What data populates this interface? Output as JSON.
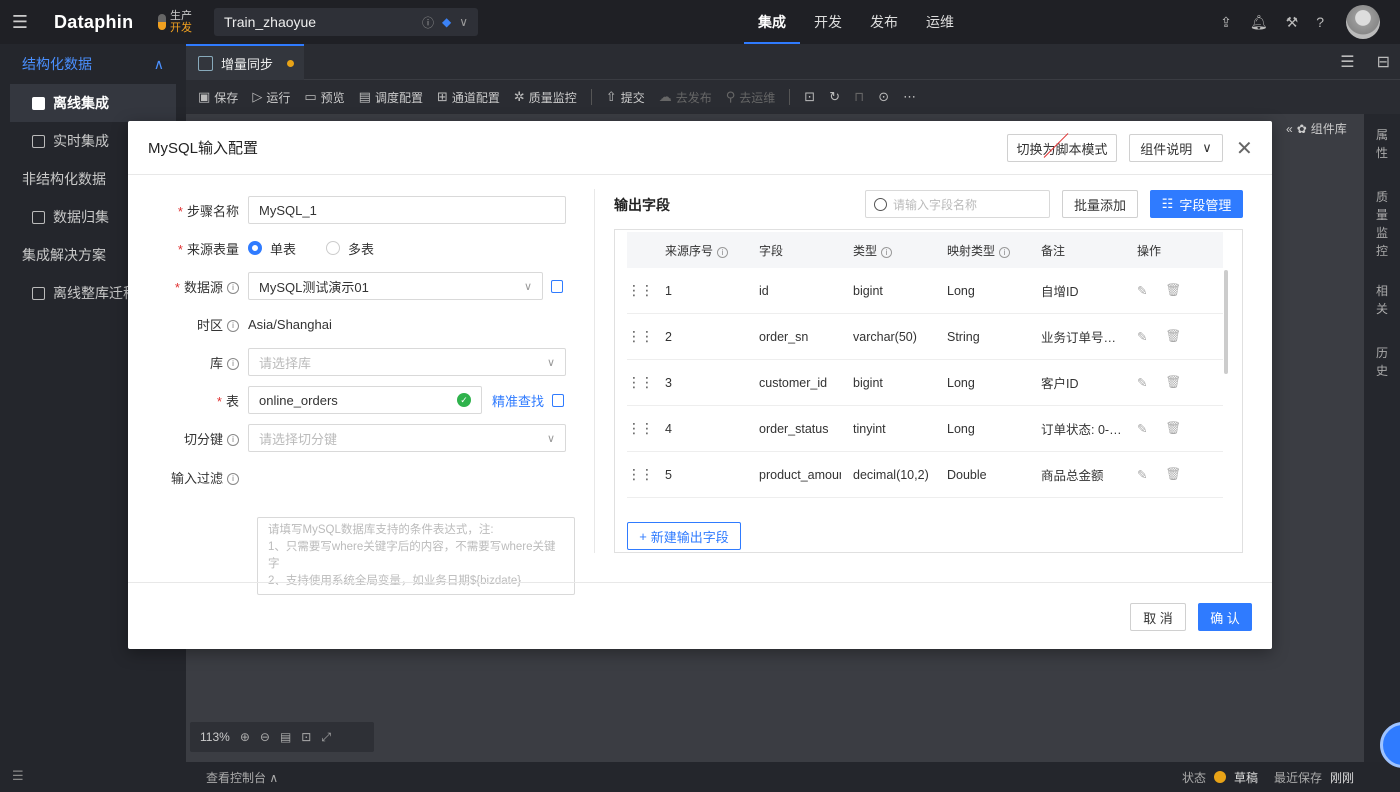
{
  "topbar": {
    "logo": "Dataphin",
    "env_prod": "生产",
    "env_dev": "开发",
    "project": "Train_zhaoyue",
    "nav": [
      "集成",
      "开发",
      "发布",
      "运维"
    ],
    "active_nav": "集成"
  },
  "sidebar": {
    "section": "结构化数据",
    "items": [
      {
        "label": "离线集成",
        "active": true
      },
      {
        "label": "实时集成",
        "active": false
      },
      {
        "label": "非结构化数据",
        "active": false
      },
      {
        "label": "数据归集",
        "active": false
      },
      {
        "label": "集成解决方案",
        "active": false
      },
      {
        "label": "离线整库迁移",
        "active": false
      }
    ]
  },
  "editor": {
    "tab": "增量同步",
    "toolbar": [
      "保存",
      "运行",
      "预览",
      "调度配置",
      "通道配置",
      "质量监控",
      "提交",
      "去发布",
      "去运维"
    ],
    "component_lib": "组件库",
    "right_panel": [
      "属性",
      "质量监控",
      "相关",
      "历史"
    ],
    "zoom": "113%",
    "console": "查看控制台",
    "status_label": "状态",
    "status_value": "草稿",
    "last_saved_label": "最近保存",
    "last_saved_value": "刚刚"
  },
  "modal": {
    "title": "MySQL输入配置",
    "switch_script": "切换为脚本模式",
    "component_doc": "组件说明",
    "form": {
      "step_name_label": "步骤名称",
      "step_name": "MySQL_1",
      "source_qty_label": "来源表量",
      "single": "单表",
      "multi": "多表",
      "datasource_label": "数据源",
      "datasource": "MySQL测试演示01",
      "timezone_label": "时区",
      "timezone": "Asia/Shanghai",
      "db_label": "库",
      "db_placeholder": "请选择库",
      "table_label": "表",
      "table": "online_orders",
      "exact_find": "精准查找",
      "split_label": "切分键",
      "split_placeholder": "请选择切分键",
      "filter_label": "输入过滤",
      "filter_placeholder_1": "请填写MySQL数据库支持的条件表达式，注:",
      "filter_placeholder_2": "1、只需要写where关键字后的内容，不需要写where关键字",
      "filter_placeholder_3": "2、支持使用系统全局变量，如业务日期${bizdate}"
    },
    "output": {
      "title": "输出字段",
      "search_placeholder": "请输入字段名称",
      "batch_add": "批量添加",
      "field_mgmt": "字段管理",
      "columns": [
        "来源序号",
        "字段",
        "类型",
        "映射类型",
        "备注",
        "操作"
      ],
      "rows": [
        {
          "idx": "1",
          "field": "id",
          "type": "bigint",
          "map": "Long",
          "note": "自增ID"
        },
        {
          "idx": "2",
          "field": "order_sn",
          "type": "varchar(50)",
          "map": "String",
          "note": "业务订单号，..."
        },
        {
          "idx": "3",
          "field": "customer_id",
          "type": "bigint",
          "map": "Long",
          "note": "客户ID"
        },
        {
          "idx": "4",
          "field": "order_status",
          "type": "tinyint",
          "map": "Long",
          "note": "订单状态: 0-待..."
        },
        {
          "idx": "5",
          "field": "product_amount",
          "type": "decimal(10,2)",
          "map": "Double",
          "note": "商品总金额"
        }
      ],
      "add_field": "新建输出字段"
    },
    "cancel": "取 消",
    "confirm": "确 认"
  }
}
